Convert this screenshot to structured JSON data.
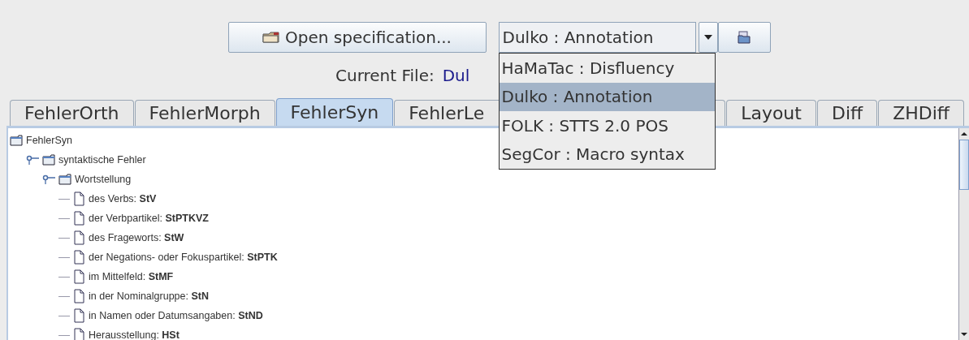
{
  "toolbar": {
    "open_button": "Open specification...",
    "combo": {
      "value": "Dulko : Annotation",
      "expanded": true,
      "options": [
        {
          "label": "HaMaTac : Disfluency",
          "selected": false
        },
        {
          "label": "Dulko : Annotation",
          "selected": true
        },
        {
          "label": "FOLK : STTS 2.0 POS",
          "selected": false
        },
        {
          "label": "SegCor : Macro syntax",
          "selected": false
        }
      ]
    }
  },
  "current_file": {
    "label": "Current File:",
    "value": "Dul"
  },
  "tabs": [
    {
      "label": "FehlerOrth",
      "selected": false
    },
    {
      "label": "FehlerMorph",
      "selected": false
    },
    {
      "label": "FehlerSyn",
      "selected": true
    },
    {
      "label": "FehlerLe",
      "selected": false
    },
    {
      "label": "Layout",
      "selected": false
    },
    {
      "label": "Diff",
      "selected": false
    },
    {
      "label": "ZHDiff",
      "selected": false
    }
  ],
  "tree": {
    "root": {
      "label": "FehlerSyn",
      "children": [
        {
          "label": "syntaktische Fehler",
          "expanded": true,
          "children": [
            {
              "label": "Wortstellung",
              "expanded": true,
              "children": [
                {
                  "label": "des Verbs: **StV**"
                },
                {
                  "label": "der Verbpartikel: **StPTKVZ**"
                },
                {
                  "label": "des Frageworts: **StW**"
                },
                {
                  "label": "der Negations- oder Fokuspartikel: **StPTK**"
                },
                {
                  "label": "im Mittelfeld: **StMF**"
                },
                {
                  "label": "in der Nominalgruppe: **StN**"
                },
                {
                  "label": "in Namen oder Datumsangaben: **StND**"
                },
                {
                  "label": "Herausstellung: **HSt**"
                }
              ]
            }
          ]
        }
      ]
    }
  }
}
